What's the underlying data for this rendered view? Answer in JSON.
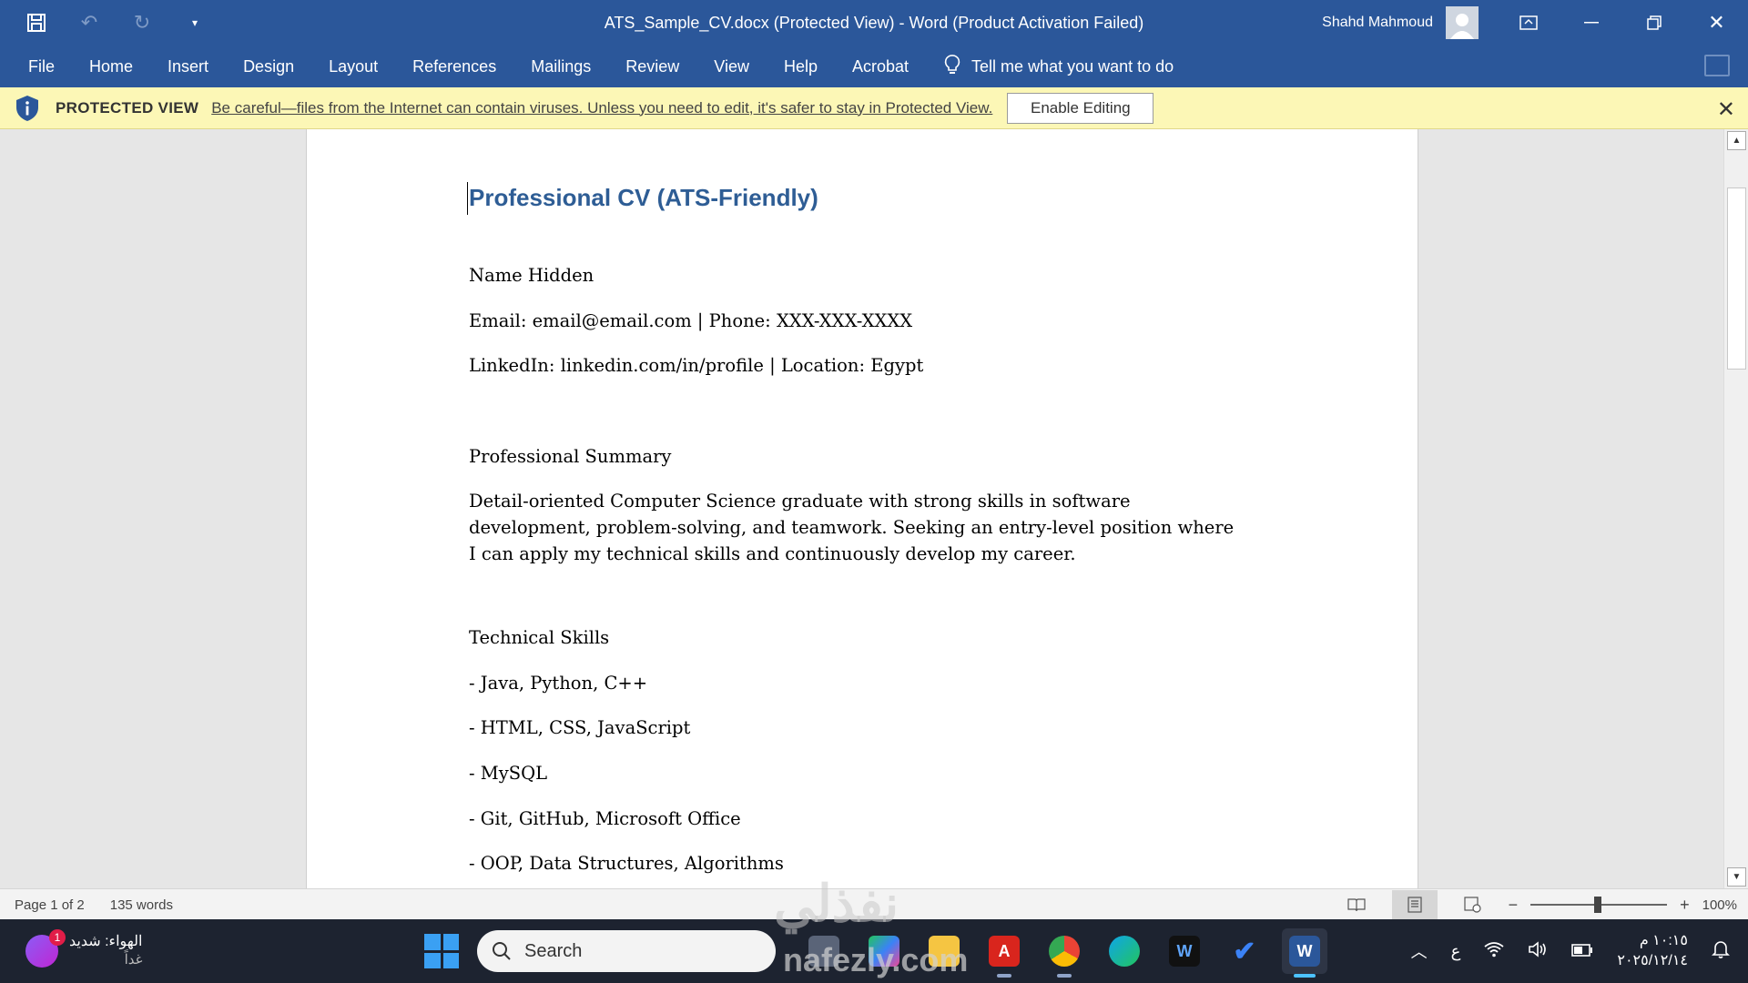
{
  "titlebar": {
    "doc_title": "ATS_Sample_CV.docx (Protected View)  -  Word (Product Activation Failed)",
    "user_name": "Shahd Mahmoud"
  },
  "ribbon": {
    "tabs": [
      "File",
      "Home",
      "Insert",
      "Design",
      "Layout",
      "References",
      "Mailings",
      "Review",
      "View",
      "Help",
      "Acrobat"
    ],
    "tell_me": "Tell me what you want to do"
  },
  "protected_view": {
    "title": "PROTECTED VIEW",
    "message": "Be careful—files from the Internet can contain viruses. Unless you need to edit, it's safer to stay in Protected View.",
    "button": "Enable Editing"
  },
  "document": {
    "title": "Professional CV (ATS-Friendly)",
    "name": "Name Hidden",
    "contact": "Email: email@email.com | Phone: XXX-XXX-XXXX",
    "links": "LinkedIn: linkedin.com/in/profile | Location: Egypt",
    "summary_heading": "Professional Summary",
    "summary": "Detail-oriented Computer Science graduate with strong skills in software development, problem-solving, and teamwork. Seeking an entry-level position where I can apply my technical skills and continuously develop my career.",
    "skills_heading": "Technical Skills",
    "skills": [
      "- Java, Python, C++",
      "- HTML, CSS, JavaScript",
      "- MySQL",
      "- Git, GitHub, Microsoft Office",
      "- OOP, Data Structures, Algorithms"
    ]
  },
  "statusbar": {
    "page": "Page 1 of 2",
    "words": "135 words",
    "zoom": "100%",
    "zoom_minus": "−",
    "zoom_plus": "+"
  },
  "taskbar": {
    "weather_title": "الهواء: شديد",
    "weather_sub": "غداً",
    "weather_badge": "1",
    "search_placeholder": "Search",
    "lang": "ع",
    "time": "١٠:١٥ م",
    "date": "٢٠٢٥/١٢/١٤"
  },
  "watermark": {
    "arabic": "نفذلي",
    "latin": "nafezly.com"
  },
  "colors": {
    "word_blue": "#2b579a",
    "protected_bar": "#fcf7b6",
    "heading_blue": "#2e5d95",
    "taskbar": "#1d2330"
  },
  "icons": [
    "save-icon",
    "undo-icon",
    "redo-icon",
    "customize-icon",
    "ribbon-display-icon",
    "minimize-icon",
    "restore-icon",
    "close-icon",
    "lightbulb-icon",
    "comment-icon",
    "shield-icon",
    "read-mode-icon",
    "print-layout-icon",
    "web-layout-icon",
    "windows-start-icon",
    "search-icon",
    "wifi-icon",
    "volume-icon",
    "battery-icon",
    "notification-icon"
  ]
}
